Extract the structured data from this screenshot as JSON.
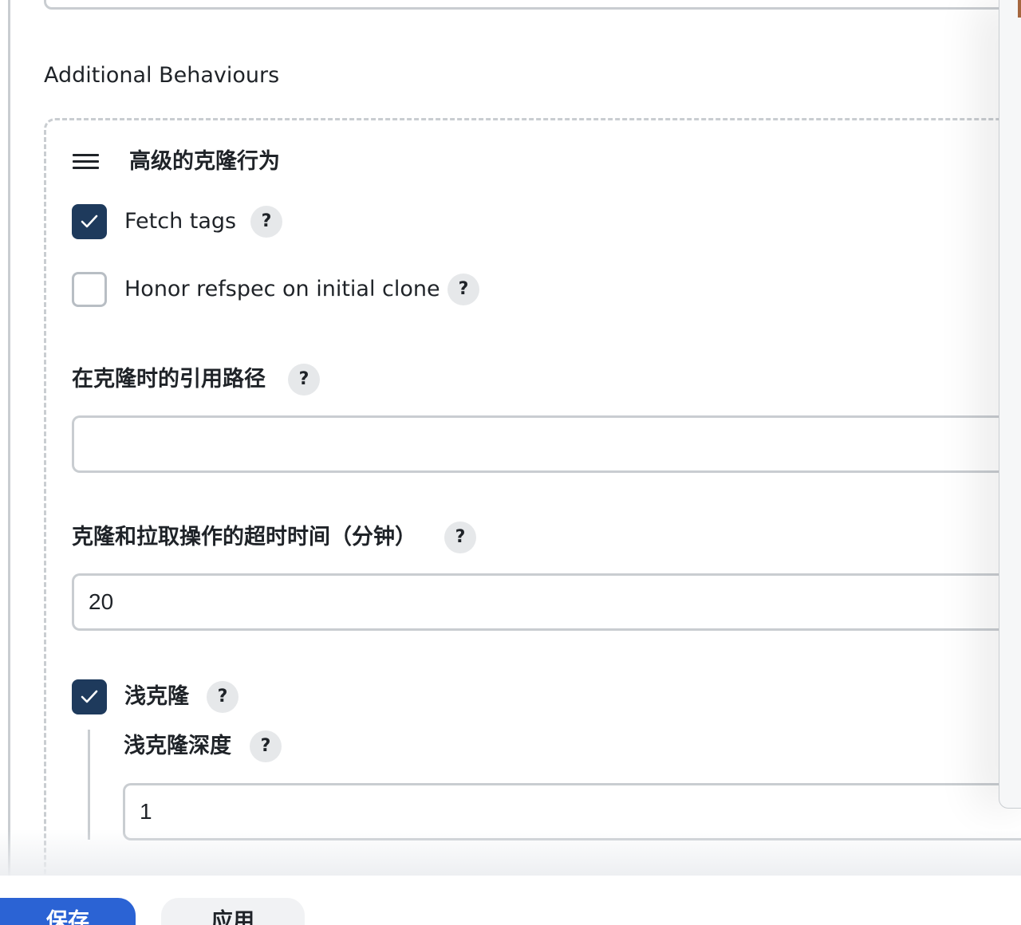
{
  "section": {
    "title": "Additional Behaviours"
  },
  "block": {
    "title": "高级的克隆行为"
  },
  "options": {
    "fetch_tags": {
      "label": "Fetch tags",
      "checked": true,
      "help": "?"
    },
    "honor_refspec": {
      "label": "Honor refspec on initial clone",
      "checked": false,
      "help": "?"
    }
  },
  "fields": {
    "reference_path": {
      "label": "在克隆时的引用路径",
      "value": "",
      "help": "?"
    },
    "timeout": {
      "label": "克隆和拉取操作的超时时间（分钟）",
      "value": "20",
      "help": "?"
    },
    "shallow_clone": {
      "label": "浅克隆",
      "checked": true,
      "help": "?"
    },
    "shallow_depth": {
      "label": "浅克隆深度",
      "value": "1",
      "help": "?"
    }
  },
  "buttons": {
    "save": "保存",
    "apply": "应用"
  },
  "icons": {
    "drag": "drag-handle-icon",
    "check": "checkmark-icon",
    "help": "help-icon"
  },
  "colors": {
    "checkbox_checked": "#1e3a5c",
    "save_button": "#2b63d4",
    "border": "#c9cdd1"
  }
}
